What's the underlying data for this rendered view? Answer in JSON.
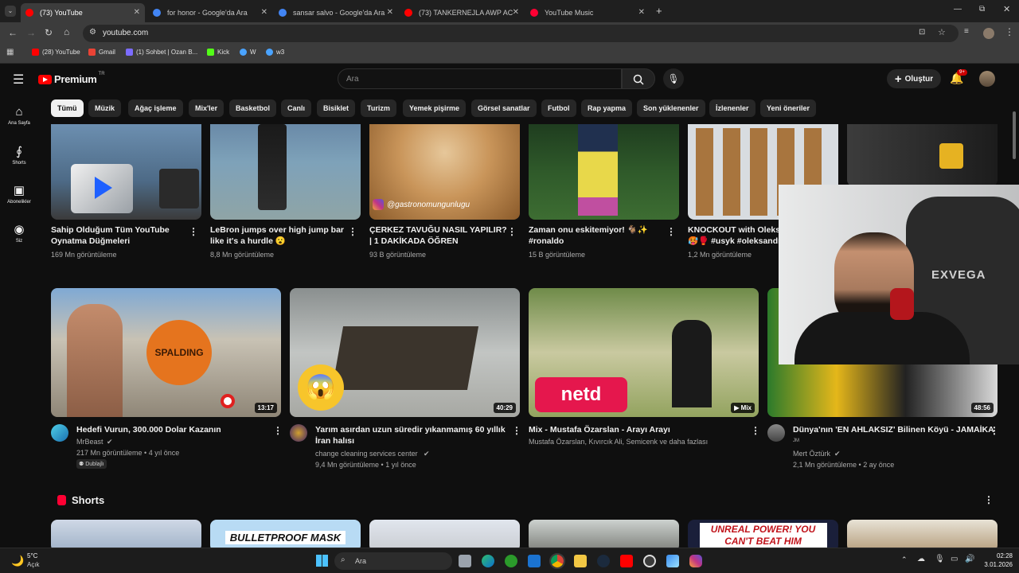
{
  "tabs": [
    {
      "label": "(73) YouTube",
      "color": "#ff0000"
    },
    {
      "label": "for honor - Google'da Ara",
      "color": "#4285f4"
    },
    {
      "label": "sansar salvo - Google'da Ara",
      "color": "#4285f4"
    },
    {
      "label": "(73) TANKERNEJLA AWP ACE - YouTube",
      "color": "#ff0000"
    },
    {
      "label": "YouTube Music",
      "color": "#ff0033"
    }
  ],
  "address": "youtube.com",
  "bookmarks": [
    {
      "label": "(28) YouTube",
      "color": "#ff0000"
    },
    {
      "label": "Gmail",
      "color": "#ea4335"
    },
    {
      "label": "(1) Sohbet | Ozan B...",
      "color": "#7c6cff"
    },
    {
      "label": "Kick",
      "color": "#53fc18"
    },
    {
      "label": "W",
      "color": "#4aa3ff"
    },
    {
      "label": "w3",
      "color": "#4aa3ff"
    }
  ],
  "header": {
    "logo": "Premium",
    "logo_sup": "TR",
    "search_placeholder": "Ara",
    "create_label": "Oluştur",
    "notif_badge": "9+"
  },
  "sidebar": [
    {
      "icon": "⌂",
      "label": "Ana Sayfa"
    },
    {
      "icon": "∮",
      "label": "Shorts"
    },
    {
      "icon": "▣",
      "label": "Abonelikler"
    },
    {
      "icon": "◉",
      "label": "Siz"
    }
  ],
  "chips": [
    "Tümü",
    "Müzik",
    "Ağaç işleme",
    "Mix'ler",
    "Basketbol",
    "Canlı",
    "Bisiklet",
    "Turizm",
    "Yemek pişirme",
    "Görsel sanatlar",
    "Futbol",
    "Rap yapma",
    "Son yüklenenler",
    "İzlenenler",
    "Yeni öneriler"
  ],
  "row1": [
    {
      "title1": "Sahip Olduğum Tüm YouTube",
      "title2": "Oynatma Düğmeleri",
      "meta": "169 Mn görüntüleme"
    },
    {
      "title1": "LeBron jumps over high jump bar",
      "title2": "like it's a hurdle 😮",
      "meta": "8,8 Mn görüntüleme"
    },
    {
      "title1": "ÇERKEZ TAVUĞU NASIL YAPILIR?",
      "title2": "| 1 DAKİKADA ÖĞREN",
      "meta": "93 B görüntüleme",
      "overlay": "@gastronomungunlugu"
    },
    {
      "title1": "Zaman onu eskitemiyor! 🐐✨",
      "title2": "#ronaldo",
      "meta": "15 B görüntüleme"
    },
    {
      "title1": "KNOCKOUT with Oleksa",
      "title2": "🥵🥊 #usyk #oleksandr",
      "meta": "1,2 Mn görüntüleme"
    }
  ],
  "row2": [
    {
      "title1": "Hedefi Vurun, 300.000 Dolar Kazanın",
      "title2": "",
      "channel": "MrBeast",
      "meta": "217 Mn görüntüleme • 4 yıl önce",
      "badge": "Dublajlı",
      "duration": "13:17",
      "thumbtext": "SPALDING"
    },
    {
      "title1": "Yarım asırdan uzun süredir yıkanmamış 60 yıllık",
      "title2": "İran halısı",
      "channel": "change cleaning services center",
      "meta": "9,4 Mn görüntüleme • 1 yıl önce",
      "duration": "40:29"
    },
    {
      "title1": "Mix - Mustafa Özarslan - Arayı Arayı",
      "title2": "",
      "channel": "Mustafa Özarslan, Kıvırcık Ali, Semicenk ve daha fazlası",
      "duration": "Mix",
      "thumbtext": "netd"
    },
    {
      "title1": "Dünya'nın 'EN AHLAKSIZ' Bilinen Köyü - JAMAİKA",
      "title2": "",
      "avatar_text": "JM",
      "channel": "Mert Öztürk",
      "meta": "2,1 Mn görüntüleme • 2 ay önce",
      "duration": "48:56"
    }
  ],
  "shorts": {
    "title": "Shorts",
    "items": [
      "",
      "BULLETPROOF MASK",
      "",
      "",
      "UNREAL POWER! YOU CAN'T BEAT HIM",
      ""
    ]
  },
  "webcam": {
    "chair_text": "EXVEGA"
  },
  "taskbar": {
    "weather_temp": "5°C",
    "weather_label": "Açık",
    "search": "Ara",
    "time": "02:28",
    "date": "3.01.2026"
  }
}
